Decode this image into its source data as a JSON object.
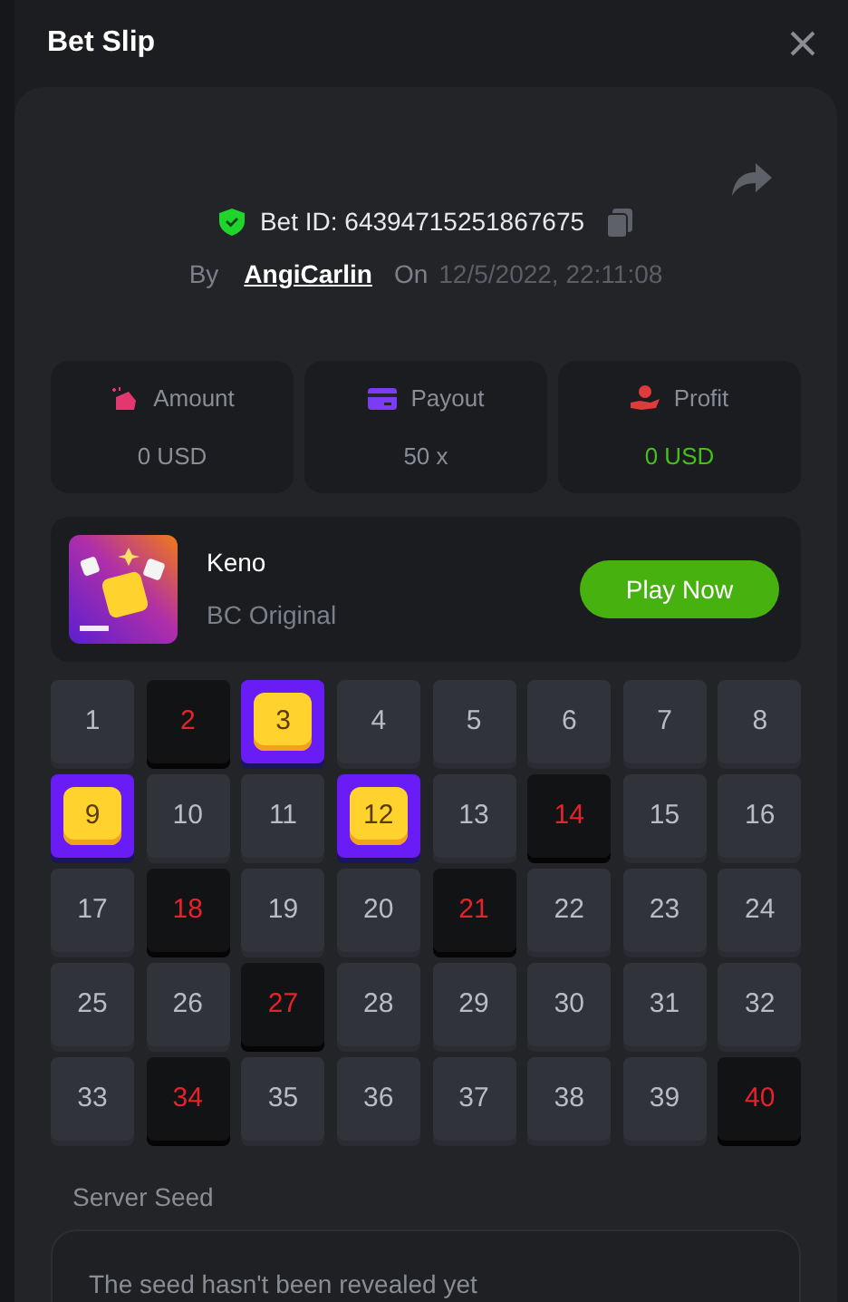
{
  "title": "Bet Slip",
  "bet": {
    "id_label": "Bet ID: 64394715251867675",
    "by_label": "By",
    "user": "AngiCarlin",
    "on_label": "On",
    "date": "12/5/2022, 22:11:08"
  },
  "stats": [
    {
      "kind": "amount",
      "label": "Amount",
      "value": "0 USD"
    },
    {
      "kind": "payout",
      "label": "Payout",
      "value": "50 x"
    },
    {
      "kind": "profit",
      "label": "Profit",
      "value": "0 USD"
    }
  ],
  "game": {
    "name": "Keno",
    "provider": "BC Original",
    "button": "Play Now"
  },
  "cells": [
    {
      "label": "1",
      "kind": "plain"
    },
    {
      "label": "2",
      "kind": "drawn"
    },
    {
      "label": "3",
      "kind": "picked"
    },
    {
      "label": "4",
      "kind": "plain"
    },
    {
      "label": "5",
      "kind": "plain"
    },
    {
      "label": "6",
      "kind": "plain"
    },
    {
      "label": "7",
      "kind": "plain"
    },
    {
      "label": "8",
      "kind": "plain"
    },
    {
      "label": "9",
      "kind": "picked"
    },
    {
      "label": "10",
      "kind": "plain"
    },
    {
      "label": "11",
      "kind": "plain"
    },
    {
      "label": "12",
      "kind": "picked"
    },
    {
      "label": "13",
      "kind": "plain"
    },
    {
      "label": "14",
      "kind": "drawn"
    },
    {
      "label": "15",
      "kind": "plain"
    },
    {
      "label": "16",
      "kind": "plain"
    },
    {
      "label": "17",
      "kind": "plain"
    },
    {
      "label": "18",
      "kind": "drawn"
    },
    {
      "label": "19",
      "kind": "plain"
    },
    {
      "label": "20",
      "kind": "plain"
    },
    {
      "label": "21",
      "kind": "drawn"
    },
    {
      "label": "22",
      "kind": "plain"
    },
    {
      "label": "23",
      "kind": "plain"
    },
    {
      "label": "24",
      "kind": "plain"
    },
    {
      "label": "25",
      "kind": "plain"
    },
    {
      "label": "26",
      "kind": "plain"
    },
    {
      "label": "27",
      "kind": "drawn"
    },
    {
      "label": "28",
      "kind": "plain"
    },
    {
      "label": "29",
      "kind": "plain"
    },
    {
      "label": "30",
      "kind": "plain"
    },
    {
      "label": "31",
      "kind": "plain"
    },
    {
      "label": "32",
      "kind": "plain"
    },
    {
      "label": "33",
      "kind": "plain"
    },
    {
      "label": "34",
      "kind": "drawn"
    },
    {
      "label": "35",
      "kind": "plain"
    },
    {
      "label": "36",
      "kind": "plain"
    },
    {
      "label": "37",
      "kind": "plain"
    },
    {
      "label": "38",
      "kind": "plain"
    },
    {
      "label": "39",
      "kind": "plain"
    },
    {
      "label": "40",
      "kind": "drawn"
    }
  ],
  "server_seed": {
    "label": "Server Seed",
    "text": "The seed hasn't been revealed yet"
  }
}
